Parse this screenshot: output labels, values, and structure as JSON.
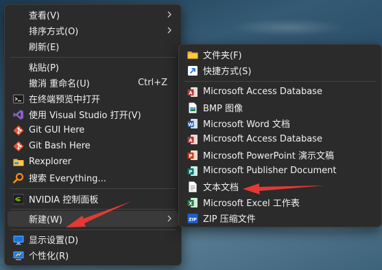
{
  "main_menu": {
    "items": [
      {
        "label": "查看(V)"
      },
      {
        "label": "排序方式(O)"
      },
      {
        "label": "刷新(E)"
      },
      {
        "label": "粘贴(P)"
      },
      {
        "label": "撤消 重命名(U)",
        "shortcut": "Ctrl+Z"
      },
      {
        "label": "在终端预览中打开"
      },
      {
        "label": "使用 Visual Studio 打开(V)"
      },
      {
        "label": "Git GUI Here"
      },
      {
        "label": "Git Bash Here"
      },
      {
        "label": "Rexplorer"
      },
      {
        "label": "搜索 Everything..."
      },
      {
        "label": "NVIDIA 控制面板"
      },
      {
        "label": "新建(W)"
      },
      {
        "label": "显示设置(D)"
      },
      {
        "label": "个性化(R)"
      }
    ]
  },
  "sub_menu": {
    "items": [
      {
        "label": "文件夹(F)"
      },
      {
        "label": "快捷方式(S)"
      },
      {
        "label": "Microsoft Access Database"
      },
      {
        "label": "BMP 图像"
      },
      {
        "label": "Microsoft Word 文档"
      },
      {
        "label": "Microsoft Access Database"
      },
      {
        "label": "Microsoft PowerPoint 演示文稿"
      },
      {
        "label": "Microsoft Publisher Document"
      },
      {
        "label": "文本文档"
      },
      {
        "label": "Microsoft Excel 工作表"
      },
      {
        "label": "ZIP 压缩文件"
      }
    ]
  },
  "colors": {
    "menu_bg": "#2b2b2b",
    "hover_bg": "#3a3a3a",
    "annotation_arrow": "#e53935"
  }
}
